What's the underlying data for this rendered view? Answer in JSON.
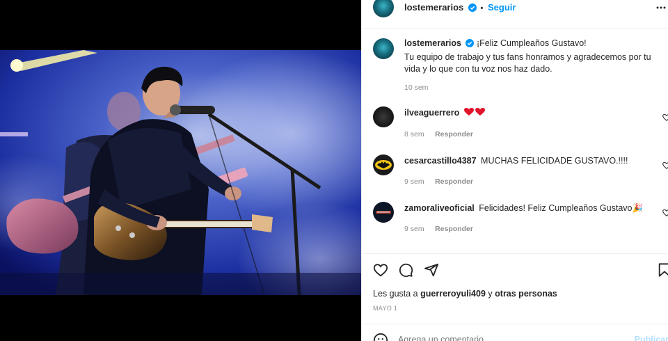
{
  "post": {
    "username": "lostemerarios",
    "follow_label": "Seguir",
    "separator": "•",
    "caption_line1": "¡Feliz Cumpleaños Gustavo!",
    "caption_body": "Tu equipo de trabajo y tus fans honramos y agradecemos por tu vida y lo que con tu voz nos haz dado.",
    "caption_time": "10 sem"
  },
  "comments": [
    {
      "username": "ilveaguerrero",
      "text": "❤️❤️",
      "time": "8 sem",
      "reply": "Responder"
    },
    {
      "username": "cesarcastillo4387",
      "text": "MUCHAS FELICIDADE GUSTAVO.!!!!",
      "time": "9 sem",
      "reply": "Responder"
    },
    {
      "username": "zamoraliveoficial",
      "text": "Felicidades! Feliz Cumpleaños Gustavo🎉",
      "time": "9 sem",
      "reply": "Responder"
    }
  ],
  "likes": {
    "prefix": "Les gusta a",
    "user": "guerreroyuli409",
    "middle": "y",
    "suffix": "otras personas"
  },
  "date": "MAYO 1",
  "comment_box": {
    "placeholder": "Agrega un comentario...",
    "publish_label": "Publicar"
  },
  "colors": {
    "accent": "#0095f6",
    "heart": "#ed4956",
    "muted": "#8e8e8e"
  }
}
